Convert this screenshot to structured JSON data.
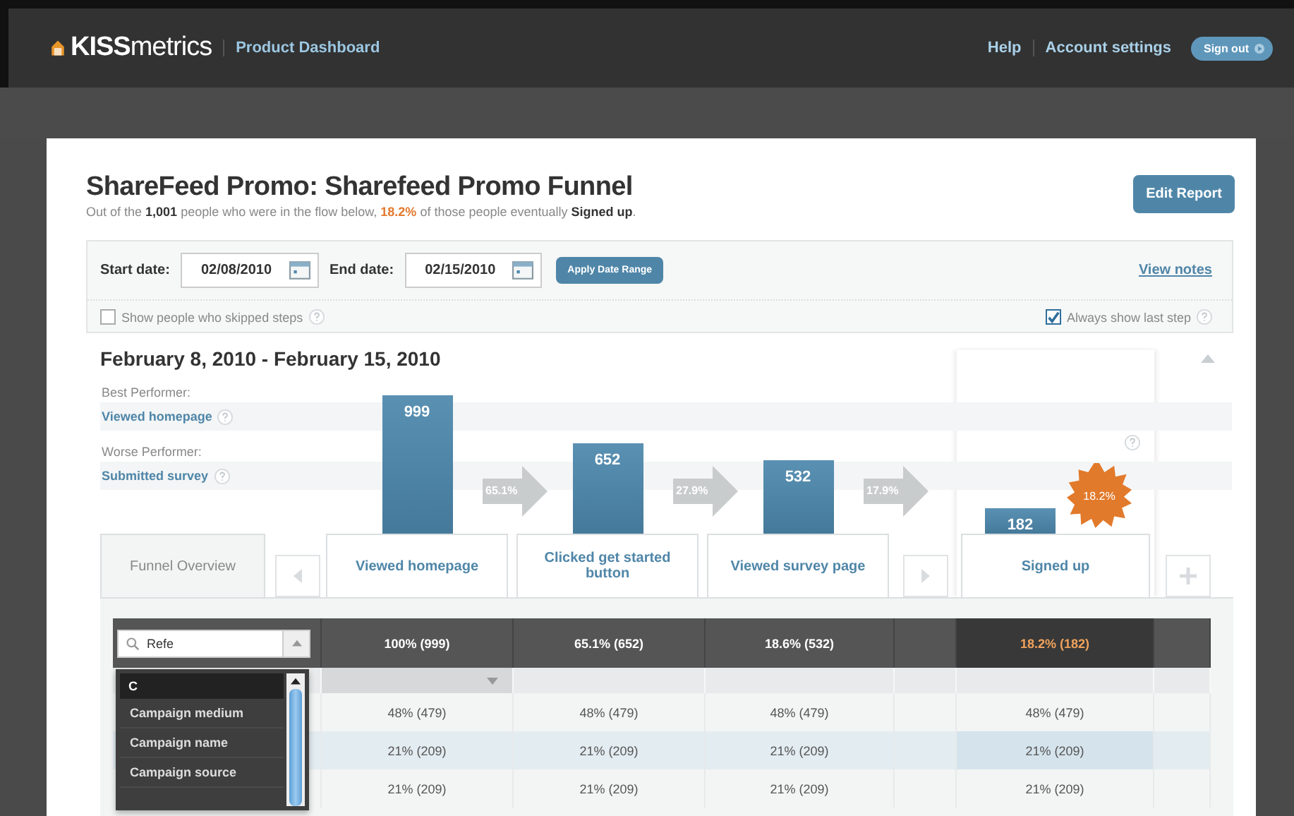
{
  "header": {
    "logo": "**KISS**metrics",
    "section": "Product Dashboard",
    "links": [
      "Help",
      "Account settings"
    ],
    "sign_out": "Sign out"
  },
  "report": {
    "title": "ShareFeed Promo: Sharefeed Promo Funnel",
    "summary": [
      {
        "text": "Out of the ",
        "kind": "plain"
      },
      {
        "text": "1,001",
        "kind": "bold"
      },
      {
        "text": " people who were in the flow below, ",
        "kind": "plain"
      },
      {
        "text": "18.2%",
        "kind": "highlight"
      },
      {
        "text": " of those people eventually ",
        "kind": "plain"
      },
      {
        "text": "Signed up",
        "kind": "bold"
      },
      {
        "text": ".",
        "kind": "plain"
      }
    ],
    "edit_button": "Edit Report"
  },
  "filters": {
    "start_label": "Start date:",
    "start_value": "02/08/2010",
    "end_label": "End date:",
    "end_value": "02/15/2010",
    "apply": "Apply Date Range",
    "view_notes": "View notes",
    "options": [
      {
        "label": "Show people who skipped steps",
        "checked": false
      },
      {
        "label": "Always show last step",
        "checked": true
      }
    ]
  },
  "range_title": "February 8, 2010 - February 15, 2010",
  "performers": [
    {
      "label": "Best Performer:",
      "step": "Viewed homepage"
    },
    {
      "label": "Worse Performer:",
      "step": "Submitted survey"
    }
  ],
  "overview_tab": "Funnel Overview",
  "steps": [
    {
      "label": "Viewed homepage",
      "count": "999",
      "conversion": "65.1%",
      "highlighted": false
    },
    {
      "label": "Clicked get started button",
      "count": "652",
      "conversion": "27.9%",
      "highlighted": false
    },
    {
      "label": "Viewed survey page",
      "count": "532",
      "conversion": "17.9%",
      "highlighted": false
    },
    {
      "label": "Signed up",
      "count": "182",
      "badge": "18.2%",
      "highlighted": true
    }
  ],
  "table": {
    "search": {
      "value": "Refe"
    },
    "totals": [
      "100% (999)",
      "65.1% (652)",
      "18.6% (532)",
      "18.2% (182)"
    ],
    "dropdown": {
      "group": "C",
      "items": [
        "Campaign medium",
        "Campaign name",
        "Campaign source"
      ]
    },
    "rows": [
      {
        "cells": [
          "48% (479)",
          "48% (479)",
          "48% (479)",
          "48% (479)"
        ],
        "selected": false
      },
      {
        "cells": [
          "21% (209)",
          "21% (209)",
          "21% (209)",
          "21% (209)"
        ],
        "selected": true
      },
      {
        "cells": [
          "21% (209)",
          "21% (209)",
          "21% (209)",
          "21% (209)"
        ],
        "selected": false
      }
    ]
  }
}
